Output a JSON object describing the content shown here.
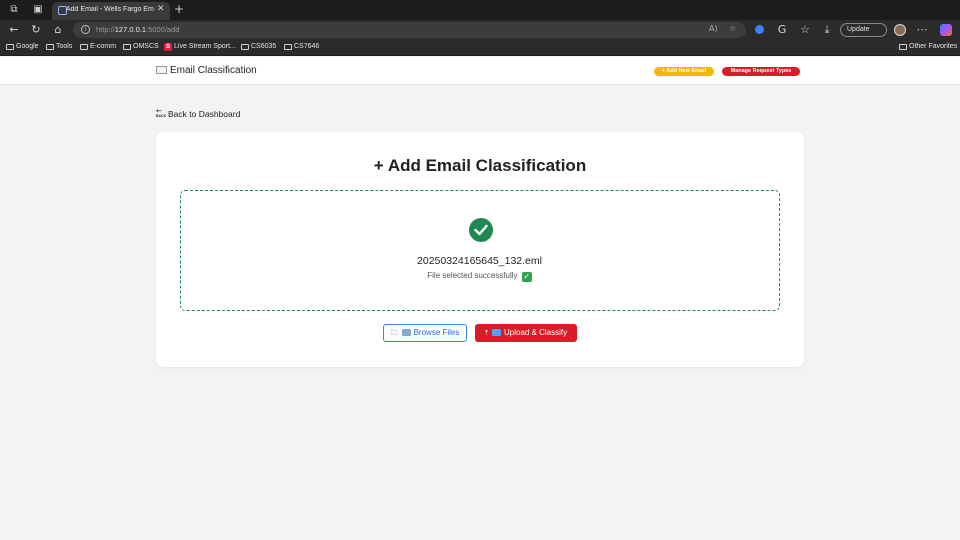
{
  "browser": {
    "tab_title": "Add Email - Wells Fargo Email C",
    "url_prefix": "http://",
    "url_host": "127.0.0.1",
    "url_path": ":5000/add",
    "update_label": "Update",
    "bookmarks": [
      "Google",
      "Tools",
      "E-comm",
      "OMSCS",
      "Live Stream Sport...",
      "CS6035",
      "CS7646"
    ],
    "other_favorites": "Other Favorites"
  },
  "nav": {
    "brand": "Email Classification",
    "add_new": "+ Add New Email",
    "manage": "Manage Request Types"
  },
  "page": {
    "back_label": "Back to Dashboard",
    "back_icon_text": "BACK",
    "title": "+ Add Email Classification",
    "file_name": "20250324165645_132.eml",
    "file_status": "File selected successfully",
    "browse_label": "Browse Files",
    "upload_label": "Upload & Classify"
  },
  "colors": {
    "accent_red": "#d71e28",
    "accent_yellow": "#f5b600",
    "success_green": "#1e8a4f",
    "link_blue": "#2563eb"
  },
  "icons": {
    "success": "check-circle-icon",
    "browse": "folder-icon",
    "upload": "upload-icon"
  }
}
